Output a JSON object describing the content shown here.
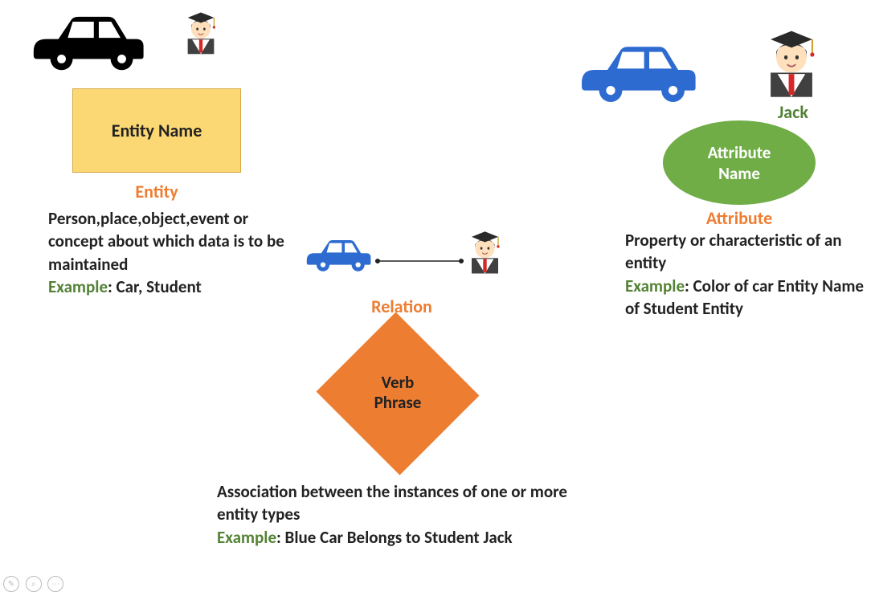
{
  "entity": {
    "shape_label": "Entity Name",
    "title": "Entity",
    "desc": "Person,place,object,event or concept about which data is to be maintained",
    "example_prefix": "Example",
    "example_text": ": Car, Student"
  },
  "relation": {
    "title": "Relation",
    "shape_label1": "Verb",
    "shape_label2": "Phrase",
    "desc": "Association between the instances of one or more entity types",
    "example_prefix": "Example",
    "example_text": ": Blue Car Belongs to Student Jack"
  },
  "attribute": {
    "jack_label": "Jack",
    "shape_label1": "Attribute",
    "shape_label2": "Name",
    "title": "Attribute",
    "desc": "Property or characteristic of an entity",
    "example_prefix": "Example",
    "example_text": ": Color of car Entity Name of Student Entity"
  }
}
